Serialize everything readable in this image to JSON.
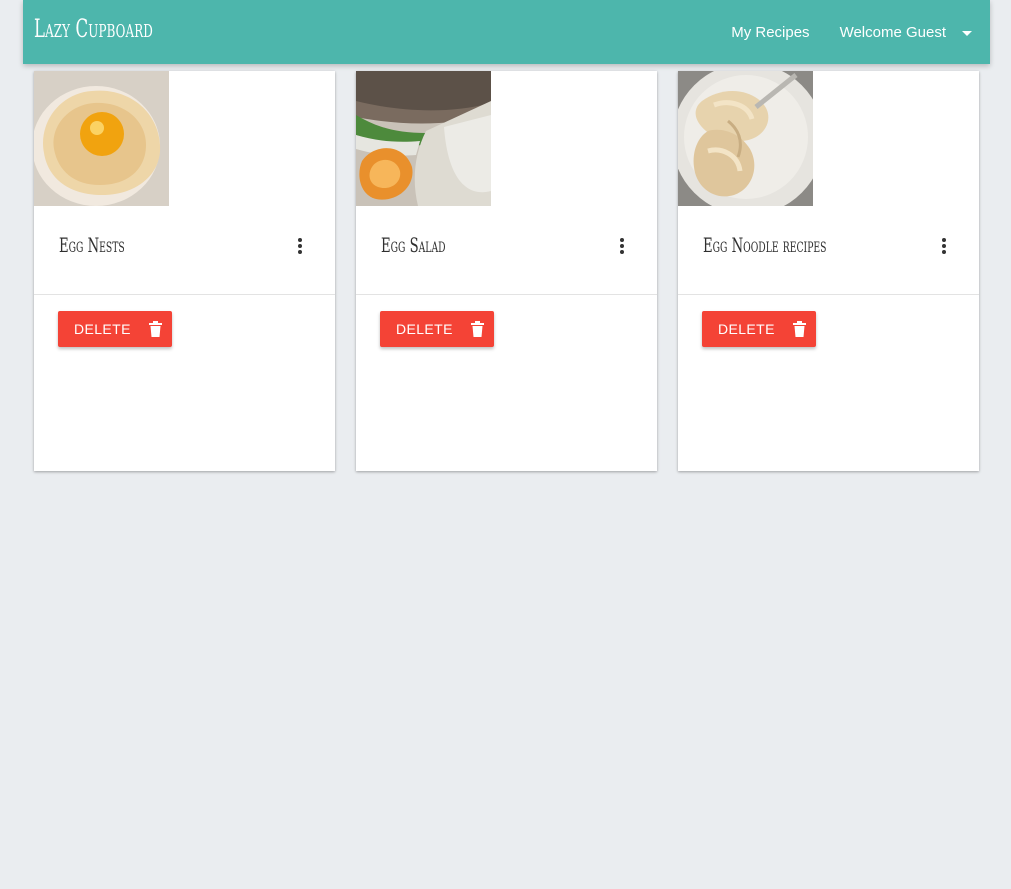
{
  "navbar": {
    "brand": "Lazy Cupboard",
    "links": {
      "my_recipes": "My Recipes",
      "welcome": "Welcome Guest"
    },
    "color": "#4db6ac"
  },
  "cards": [
    {
      "title": "Egg Nests",
      "delete_label": "DELETE"
    },
    {
      "title": "Egg Salad",
      "delete_label": "DELETE"
    },
    {
      "title": "Egg Noodle recipes",
      "delete_label": "DELETE"
    }
  ],
  "icons": {
    "dropdown": "caret-down-icon",
    "more": "more-vert-icon",
    "delete": "trash-icon"
  },
  "colors": {
    "background": "#eaedf0",
    "delete_button": "#f44336"
  }
}
